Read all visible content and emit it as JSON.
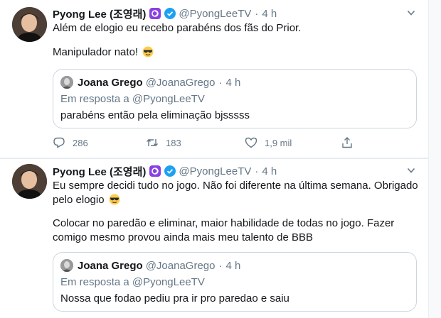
{
  "tweets": [
    {
      "name": "Pyong Lee (조영래)",
      "handle": "@PyongLeeTV",
      "time": "4 h",
      "paragraphs": [
        "Além de elogio eu recebo parabéns dos fãs do Prior.",
        "Manipulador nato!"
      ],
      "emoji": "smiling-face-with-sunglasses",
      "quote": {
        "name": "Joana Grego",
        "handle": "@JoanaGrego",
        "time": "4 h",
        "reply_to": "Em resposta a @PyongLeeTV",
        "text": "parabéns então pela eliminação bjsssss"
      },
      "actions": {
        "replies": "286",
        "retweets": "183",
        "likes": "1,9 mil"
      }
    },
    {
      "name": "Pyong Lee (조영래)",
      "handle": "@PyongLeeTV",
      "time": "4 h",
      "paragraphs": [
        "Eu sempre decidi tudo no jogo. Não foi diferente na última semana. Obrigado pelo elogio",
        "Colocar no paredão e eliminar, maior habilidade de todas no jogo. Fazer comigo mesmo provou ainda mais meu talento de BBB"
      ],
      "emoji": "smiling-face-with-sunglasses",
      "quote": {
        "name": "Joana Grego",
        "handle": "@JoanaGrego",
        "time": "4 h",
        "reply_to": "Em resposta a @PyongLeeTV",
        "text": "Nossa que fodao pediu pra ir pro paredao e saiu"
      }
    }
  ],
  "separator": "·",
  "colors": {
    "verified": "#1da1f2",
    "ig_badge": "#8a3fe3",
    "muted": "#657786"
  }
}
